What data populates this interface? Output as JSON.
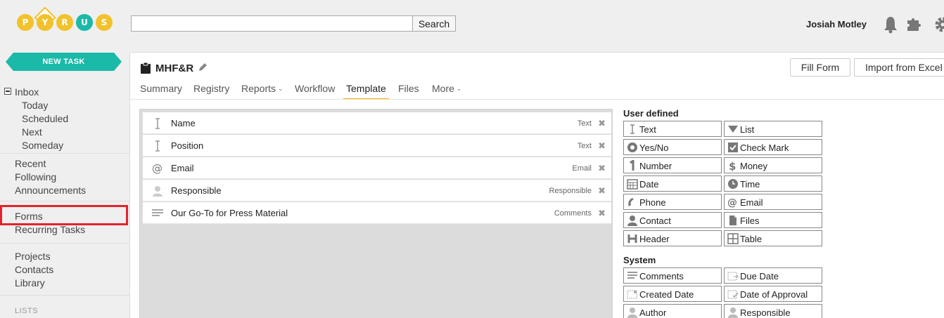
{
  "app": {
    "logo_letters": [
      "P",
      "Y",
      "R",
      "U",
      "S"
    ],
    "colors": {
      "accent_teal": "#1ab9a8",
      "logo_yellow": "#f2c22c",
      "highlight_red": "#e3232a",
      "tab_underline": "#f0b400"
    }
  },
  "header": {
    "search": {
      "value": "",
      "placeholder": "",
      "button_label": "Search"
    },
    "user_name": "Josiah Motley",
    "icons": [
      "bell-icon",
      "puzzle-icon",
      "gear-icon"
    ]
  },
  "sidebar": {
    "new_task_label": "NEW TASK",
    "inbox": {
      "label": "Inbox",
      "children": [
        "Today",
        "Scheduled",
        "Next",
        "Someday"
      ]
    },
    "group2": [
      "Recent",
      "Following",
      "Announcements"
    ],
    "group3": [
      "Forms",
      "Recurring Tasks"
    ],
    "group4": [
      "Projects",
      "Contacts",
      "Library"
    ],
    "lists_heading": "LISTS"
  },
  "form": {
    "title": "MHF&R",
    "fill_form_label": "Fill Form",
    "import_label": "Import from Excel",
    "tabs": [
      {
        "label": "Summary"
      },
      {
        "label": "Registry"
      },
      {
        "label": "Reports",
        "dropdown": true
      },
      {
        "label": "Workflow"
      },
      {
        "label": "Template",
        "active": true
      },
      {
        "label": "Files"
      },
      {
        "label": "More",
        "dropdown": true
      }
    ],
    "fields": [
      {
        "label": "Name",
        "type": "Text",
        "icon": "text-cursor-icon"
      },
      {
        "label": "Position",
        "type": "Text",
        "icon": "text-cursor-icon"
      },
      {
        "label": "Email",
        "type": "Email",
        "icon": "at-icon"
      },
      {
        "label": "Responsible",
        "type": "Responsible",
        "icon": "person-icon"
      },
      {
        "label": "Our Go-To for Press Material",
        "type": "Comments",
        "icon": "lines-icon"
      }
    ]
  },
  "palette": {
    "user_defined_heading": "User defined",
    "user_defined": [
      {
        "label": "Text",
        "icon": "text-cursor-icon"
      },
      {
        "label": "List",
        "icon": "triangle-down-icon"
      },
      {
        "label": "Yes/No",
        "icon": "radio-icon"
      },
      {
        "label": "Check Mark",
        "icon": "checkbox-icon"
      },
      {
        "label": "Number",
        "icon": "number-icon"
      },
      {
        "label": "Money",
        "icon": "dollar-icon"
      },
      {
        "label": "Date",
        "icon": "calendar-icon"
      },
      {
        "label": "Time",
        "icon": "clock-icon"
      },
      {
        "label": "Phone",
        "icon": "phone-icon"
      },
      {
        "label": "Email",
        "icon": "at-icon"
      },
      {
        "label": "Contact",
        "icon": "person-icon"
      },
      {
        "label": "Files",
        "icon": "file-icon"
      },
      {
        "label": "Header",
        "icon": "header-icon"
      },
      {
        "label": "Table",
        "icon": "table-icon"
      }
    ],
    "system_heading": "System",
    "system": [
      {
        "label": "Comments",
        "icon": "lines-icon"
      },
      {
        "label": "Due Date",
        "icon": "due-date-icon"
      },
      {
        "label": "Created Date",
        "icon": "created-date-icon"
      },
      {
        "label": "Date of Approval",
        "icon": "approval-date-icon"
      },
      {
        "label": "Author",
        "icon": "person-icon"
      },
      {
        "label": "Responsible",
        "icon": "person-icon"
      }
    ]
  }
}
